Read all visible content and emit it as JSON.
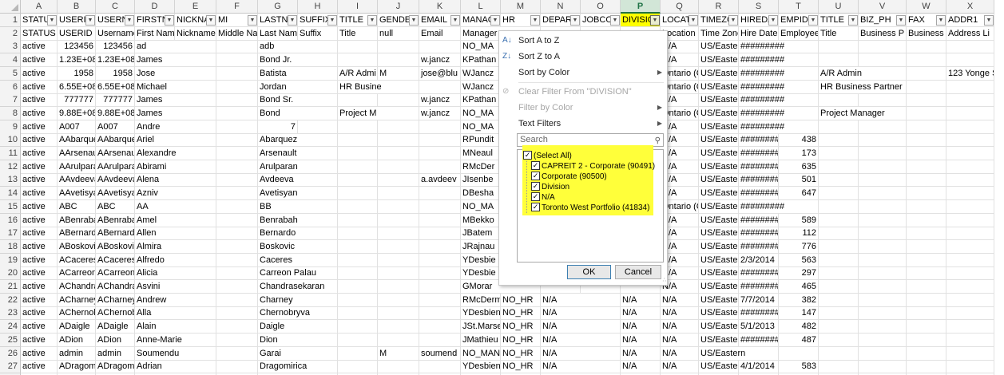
{
  "columns": [
    "A",
    "B",
    "C",
    "D",
    "E",
    "F",
    "G",
    "H",
    "I",
    "J",
    "K",
    "L",
    "M",
    "N",
    "O",
    "P",
    "Q",
    "R",
    "S",
    "T",
    "U",
    "V",
    "W",
    "X"
  ],
  "selected_column": "P",
  "header_row": [
    "STATUS",
    "USERID",
    "USERNAME",
    "FIRSTNAME",
    "NICKNAME",
    "MI",
    "LASTNAME",
    "SUFFIX",
    "TITLE",
    "GENDER",
    "EMAIL",
    "MANAGER",
    "HR",
    "DEPARTMENT",
    "JOBCODE",
    "DIVISION",
    "LOCATION",
    "TIMEZONE",
    "HIREDATE",
    "EMPID",
    "TITLE",
    "BIZ_PHONE",
    "FAX",
    "ADDR1"
  ],
  "header_display": [
    "STATUS",
    "USERID",
    "USERNA",
    "FIRSTN",
    "NICKNA",
    "MI",
    "LASTNA",
    "SUFFIX",
    "TITLE",
    "GENDE",
    "EMAIL",
    "MANAG",
    "HR",
    "DEPART",
    "JOBCOI",
    "DIVISIO",
    "LOCATI",
    "TIMEZC",
    "HIREDA",
    "EMPID",
    "TITLE",
    "BIZ_PH",
    "FAX",
    "ADDR1"
  ],
  "row_numbers": [
    "1",
    "2",
    "3",
    "4",
    "5",
    "6",
    "7",
    "8",
    "9",
    "10",
    "11",
    "12",
    "13",
    "14",
    "15",
    "16",
    "17",
    "18",
    "19",
    "20",
    "21",
    "22",
    "23",
    "24",
    "25",
    "26",
    "27",
    "28"
  ],
  "rows": [
    [
      "STATUS",
      "USERID",
      "Username",
      "First Name",
      "Nickname",
      "Middle Name",
      "Last Name",
      "Suffix",
      "Title",
      "null",
      "Email",
      "Manager",
      "",
      "",
      "",
      "",
      "Location",
      "Time Zone",
      "Hire Date",
      "Employee",
      "Title",
      "Business P",
      "Business F",
      "Address Li"
    ],
    [
      "active",
      "123456",
      "123456",
      "ad",
      "",
      "",
      "adb",
      "",
      "",
      "",
      "",
      "NO_MA",
      "",
      "",
      "",
      "",
      "N/A",
      "US/Easter",
      "#########",
      "",
      "",
      "",
      "",
      ""
    ],
    [
      "active",
      "1.23E+08",
      "1.23E+08",
      "James",
      "",
      "",
      "Bond Jr.",
      "",
      "",
      "",
      "w.jancz",
      "KPathan",
      "",
      "",
      "",
      "",
      "N/A",
      "US/Easter",
      "#########",
      "",
      "",
      "",
      "",
      ""
    ],
    [
      "active",
      "1958",
      "1958",
      "Jose",
      "",
      "",
      "Batista",
      "",
      "A/R Admi",
      "M",
      "jose@blu",
      "WJancz",
      "",
      "",
      "",
      "",
      "Ontario (C",
      "US/Easter",
      "#########",
      "",
      "A/R Admin",
      "",
      "",
      "123 Yonge St"
    ],
    [
      "active",
      "6.55E+08",
      "6.55E+08",
      "Michael",
      "",
      "",
      "Jordan",
      "",
      "HR Busine",
      "",
      "",
      "WJancz",
      "",
      "",
      "",
      "",
      "Ontario (C",
      "US/Easter",
      "#########",
      "",
      "HR Business Partner",
      "",
      "",
      ""
    ],
    [
      "active",
      "777777",
      "777777",
      "James",
      "",
      "",
      "Bond Sr.",
      "",
      "",
      "",
      "w.jancz",
      "KPathan",
      "",
      "",
      "",
      "",
      "N/A",
      "US/Easter",
      "#########",
      "",
      "",
      "",
      "",
      ""
    ],
    [
      "active",
      "9.88E+08",
      "9.88E+08",
      "James",
      "",
      "",
      "Bond",
      "",
      "Project M",
      "",
      "w.jancz",
      "NO_MA",
      "",
      "",
      "",
      "",
      "Ontario (C",
      "US/Easter",
      "#########",
      "",
      "Project Manager",
      "",
      "",
      ""
    ],
    [
      "active",
      "A007",
      "A007",
      "Andre",
      "",
      "",
      "7",
      "",
      "",
      "",
      "",
      "NO_MA",
      "",
      "",
      "",
      "",
      "N/A",
      "US/Easter",
      "#########",
      "",
      "",
      "",
      "",
      ""
    ],
    [
      "active",
      "AAbarque",
      "AAbarque",
      "Ariel",
      "",
      "",
      "Abarquez",
      "",
      "",
      "",
      "",
      "RPundit",
      "",
      "",
      "",
      "",
      "N/A",
      "US/Easter",
      "#########",
      "438",
      "",
      "",
      "",
      ""
    ],
    [
      "active",
      "AArsenau",
      "AArsenau",
      "Alexandre",
      "",
      "",
      "Arsenault",
      "",
      "",
      "",
      "",
      "MNeaul",
      "",
      "",
      "",
      "",
      "N/A",
      "US/Easter",
      "#########",
      "173",
      "",
      "",
      "",
      ""
    ],
    [
      "active",
      "AArulpara",
      "AArulpara",
      "Abirami",
      "",
      "",
      "Arulparan",
      "",
      "",
      "",
      "",
      "RMcDer",
      "",
      "",
      "",
      "",
      "N/A",
      "US/Easter",
      "#########",
      "635",
      "",
      "",
      "",
      ""
    ],
    [
      "active",
      "AAvdeeva",
      "AAvdeeva",
      "Alena",
      "",
      "",
      "Avdeeva",
      "",
      "",
      "",
      "a.avdeev",
      "JIsenbe",
      "",
      "",
      "",
      "",
      "N/A",
      "US/Easter",
      "#########",
      "501",
      "",
      "",
      "",
      ""
    ],
    [
      "active",
      "AAvetisya",
      "AAvetisya",
      "Azniv",
      "",
      "",
      "Avetisyan",
      "",
      "",
      "",
      "",
      "DBesha",
      "",
      "",
      "",
      "",
      "N/A",
      "US/Easter",
      "#########",
      "647",
      "",
      "",
      "",
      ""
    ],
    [
      "active",
      "ABC",
      "ABC",
      "AA",
      "",
      "",
      "BB",
      "",
      "",
      "",
      "",
      "NO_MA",
      "",
      "",
      "",
      "",
      "Ontario (C",
      "US/Easter",
      "#########",
      "",
      "",
      "",
      "",
      ""
    ],
    [
      "active",
      "ABenraba",
      "ABenraba",
      "Amel",
      "",
      "",
      "Benrabah",
      "",
      "",
      "",
      "",
      "MBekko",
      "",
      "",
      "",
      "",
      "N/A",
      "US/Easter",
      "#########",
      "589",
      "",
      "",
      "",
      ""
    ],
    [
      "active",
      "ABernard",
      "ABernard",
      "Allen",
      "",
      "",
      "Bernardo",
      "",
      "",
      "",
      "",
      "JBatem",
      "",
      "",
      "",
      "",
      "N/A",
      "US/Easter",
      "#########",
      "112",
      "",
      "",
      "",
      ""
    ],
    [
      "active",
      "ABoskovic",
      "ABoskovic",
      "Almira",
      "",
      "",
      "Boskovic",
      "",
      "",
      "",
      "",
      "JRajnau",
      "",
      "",
      "",
      "",
      "N/A",
      "US/Easter",
      "#########",
      "776",
      "",
      "",
      "",
      ""
    ],
    [
      "active",
      "ACaceres",
      "ACaceres",
      "Alfredo",
      "",
      "",
      "Caceres",
      "",
      "",
      "",
      "",
      "YDesbie",
      "",
      "",
      "",
      "",
      "N/A",
      "US/Easter",
      "2/3/2014",
      "563",
      "",
      "",
      "",
      ""
    ],
    [
      "active",
      "ACarreon",
      "ACarreon",
      "Alicia",
      "",
      "",
      "Carreon Palau",
      "",
      "",
      "",
      "",
      "YDesbie",
      "",
      "",
      "",
      "",
      "N/A",
      "US/Easter",
      "#########",
      "297",
      "",
      "",
      "",
      ""
    ],
    [
      "active",
      "AChandra",
      "AChandra",
      "Asvini",
      "",
      "",
      "Chandrasekaran",
      "",
      "",
      "",
      "",
      "GMorar",
      "",
      "",
      "",
      "",
      "N/A",
      "US/Easter",
      "#########",
      "465",
      "",
      "",
      "",
      ""
    ],
    [
      "active",
      "ACharney",
      "ACharney",
      "Andrew",
      "",
      "",
      "Charney",
      "",
      "",
      "",
      "",
      "RMcDerm",
      "NO_HR",
      "N/A",
      "",
      "N/A",
      "N/A",
      "US/Easter",
      "7/7/2014",
      "382",
      "",
      "",
      "",
      ""
    ],
    [
      "active",
      "AChernob",
      "AChernob",
      "Alla",
      "",
      "",
      "Chernobryva",
      "",
      "",
      "",
      "",
      "YDesbiens",
      "NO_HR",
      "N/A",
      "",
      "N/A",
      "N/A",
      "US/Easter",
      "#########",
      "147",
      "",
      "",
      "",
      ""
    ],
    [
      "active",
      "ADaigle",
      "ADaigle",
      "Alain",
      "",
      "",
      "Daigle",
      "",
      "",
      "",
      "",
      "JSt.Marsei",
      "NO_HR",
      "N/A",
      "",
      "N/A",
      "N/A",
      "US/Easter",
      "5/1/2013",
      "482",
      "",
      "",
      "",
      ""
    ],
    [
      "active",
      "ADion",
      "ADion",
      "Anne-Marie",
      "",
      "",
      "Dion",
      "",
      "",
      "",
      "",
      "JMathieu",
      "NO_HR",
      "N/A",
      "",
      "N/A",
      "N/A",
      "US/Easter",
      "#########",
      "487",
      "",
      "",
      "",
      ""
    ],
    [
      "active",
      "admin",
      "admin",
      "Soumendu",
      "",
      "",
      "Garai",
      "",
      "",
      "M",
      "soumend",
      "NO_MAN",
      "NO_HR",
      "N/A",
      "",
      "N/A",
      "N/A",
      "US/Eastern",
      "",
      "",
      "",
      "",
      "",
      ""
    ],
    [
      "active",
      "ADragomi",
      "ADragomi",
      "Adrian",
      "",
      "",
      "Dragomirica",
      "",
      "",
      "",
      "",
      "YDesbiens",
      "NO_HR",
      "N/A",
      "",
      "N/A",
      "N/A",
      "US/Easter",
      "4/1/2014",
      "583",
      "",
      "",
      "",
      ""
    ],
    [
      "active",
      "ADrolet",
      "ADrolet",
      "Ariane",
      "",
      "",
      "Drolet",
      "",
      "",
      "",
      "",
      "MPin",
      "NO_HR",
      "N/A",
      "",
      "N/A",
      "N/A",
      "US/Easter",
      "#########",
      "738",
      "",
      "",
      "",
      ""
    ]
  ],
  "filter_menu": {
    "sort_az": "Sort A to Z",
    "sort_za": "Sort Z to A",
    "sort_color": "Sort by Color",
    "clear_filter": "Clear Filter From \"DIVISION\"",
    "filter_color": "Filter by Color",
    "text_filters": "Text Filters",
    "search_placeholder": "Search",
    "items": [
      "(Select All)",
      "CAPREIT 2 - Corporate (90491)",
      "Corporate (90500)",
      "Division",
      "N/A",
      "Toronto West Portfolio (41834)"
    ],
    "ok": "OK",
    "cancel": "Cancel"
  }
}
